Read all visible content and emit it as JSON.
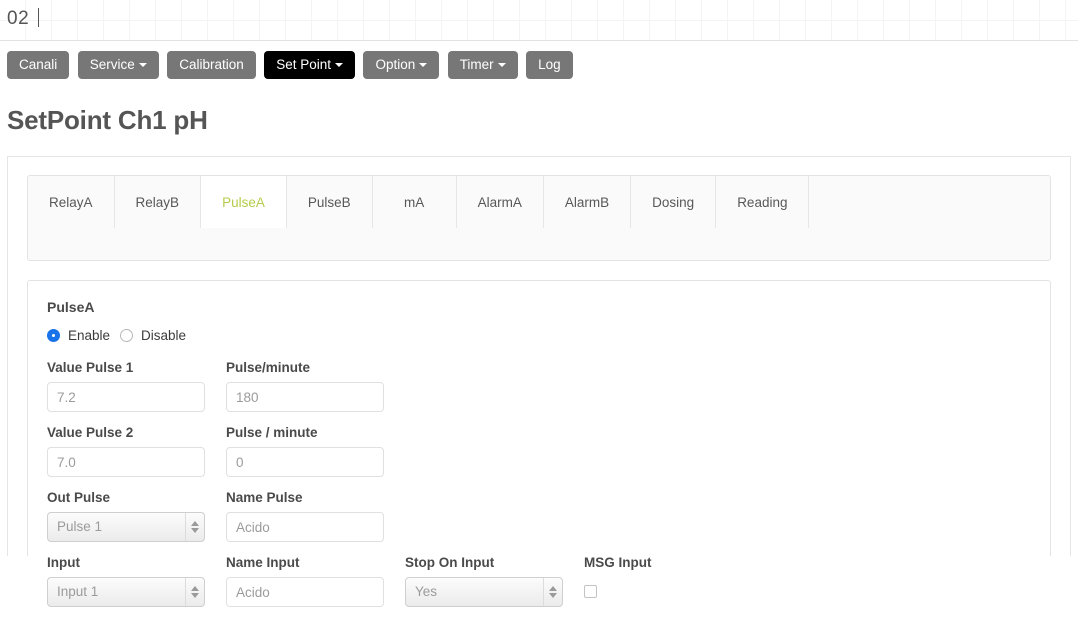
{
  "topbar": {
    "text": "02",
    "cursor": "|"
  },
  "navbar": {
    "items": [
      {
        "label": "Canali",
        "caret": false,
        "active": false
      },
      {
        "label": "Service",
        "caret": true,
        "active": false
      },
      {
        "label": "Calibration",
        "caret": false,
        "active": false
      },
      {
        "label": "Set Point",
        "caret": true,
        "active": true
      },
      {
        "label": "Option",
        "caret": true,
        "active": false
      },
      {
        "label": "Timer",
        "caret": true,
        "active": false
      },
      {
        "label": "Log",
        "caret": false,
        "active": false
      }
    ]
  },
  "page": {
    "title": "SetPoint Ch1 pH"
  },
  "tabs": {
    "items": [
      {
        "label": "RelayA",
        "active": false
      },
      {
        "label": "RelayB",
        "active": false
      },
      {
        "label": "PulseA",
        "active": true
      },
      {
        "label": "PulseB",
        "active": false
      },
      {
        "label": "mA",
        "active": false
      },
      {
        "label": "AlarmA",
        "active": false
      },
      {
        "label": "AlarmB",
        "active": false
      },
      {
        "label": "Dosing",
        "active": false
      },
      {
        "label": "Reading",
        "active": false
      }
    ],
    "active_color": "#b5cc4a"
  },
  "form": {
    "section_title": "PulseA",
    "enable_label": "Enable",
    "disable_label": "Disable",
    "enable_checked": true,
    "disable_checked": false,
    "fields": {
      "value_pulse_1": {
        "label": "Value Pulse 1",
        "value": "7.2",
        "placeholder": "7.2"
      },
      "pulse_minute_1": {
        "label": "Pulse/minute",
        "value": "180",
        "placeholder": "180"
      },
      "value_pulse_2": {
        "label": "Value Pulse 2",
        "value": "7.0",
        "placeholder": "7.0"
      },
      "pulse_minute_2": {
        "label": "Pulse / minute",
        "value": "0",
        "placeholder": "0"
      },
      "out_pulse": {
        "label": "Out Pulse",
        "value": "Pulse 1"
      },
      "name_pulse": {
        "label": "Name Pulse",
        "value": "Acido",
        "placeholder": "Acido"
      },
      "input": {
        "label": "Input",
        "value": "Input 1"
      },
      "name_input": {
        "label": "Name Input",
        "value": "Acido",
        "placeholder": "Acido"
      },
      "stop_on_input": {
        "label": "Stop On Input",
        "value": "Yes"
      },
      "msg_input": {
        "label": "MSG Input",
        "checked": false
      }
    }
  }
}
